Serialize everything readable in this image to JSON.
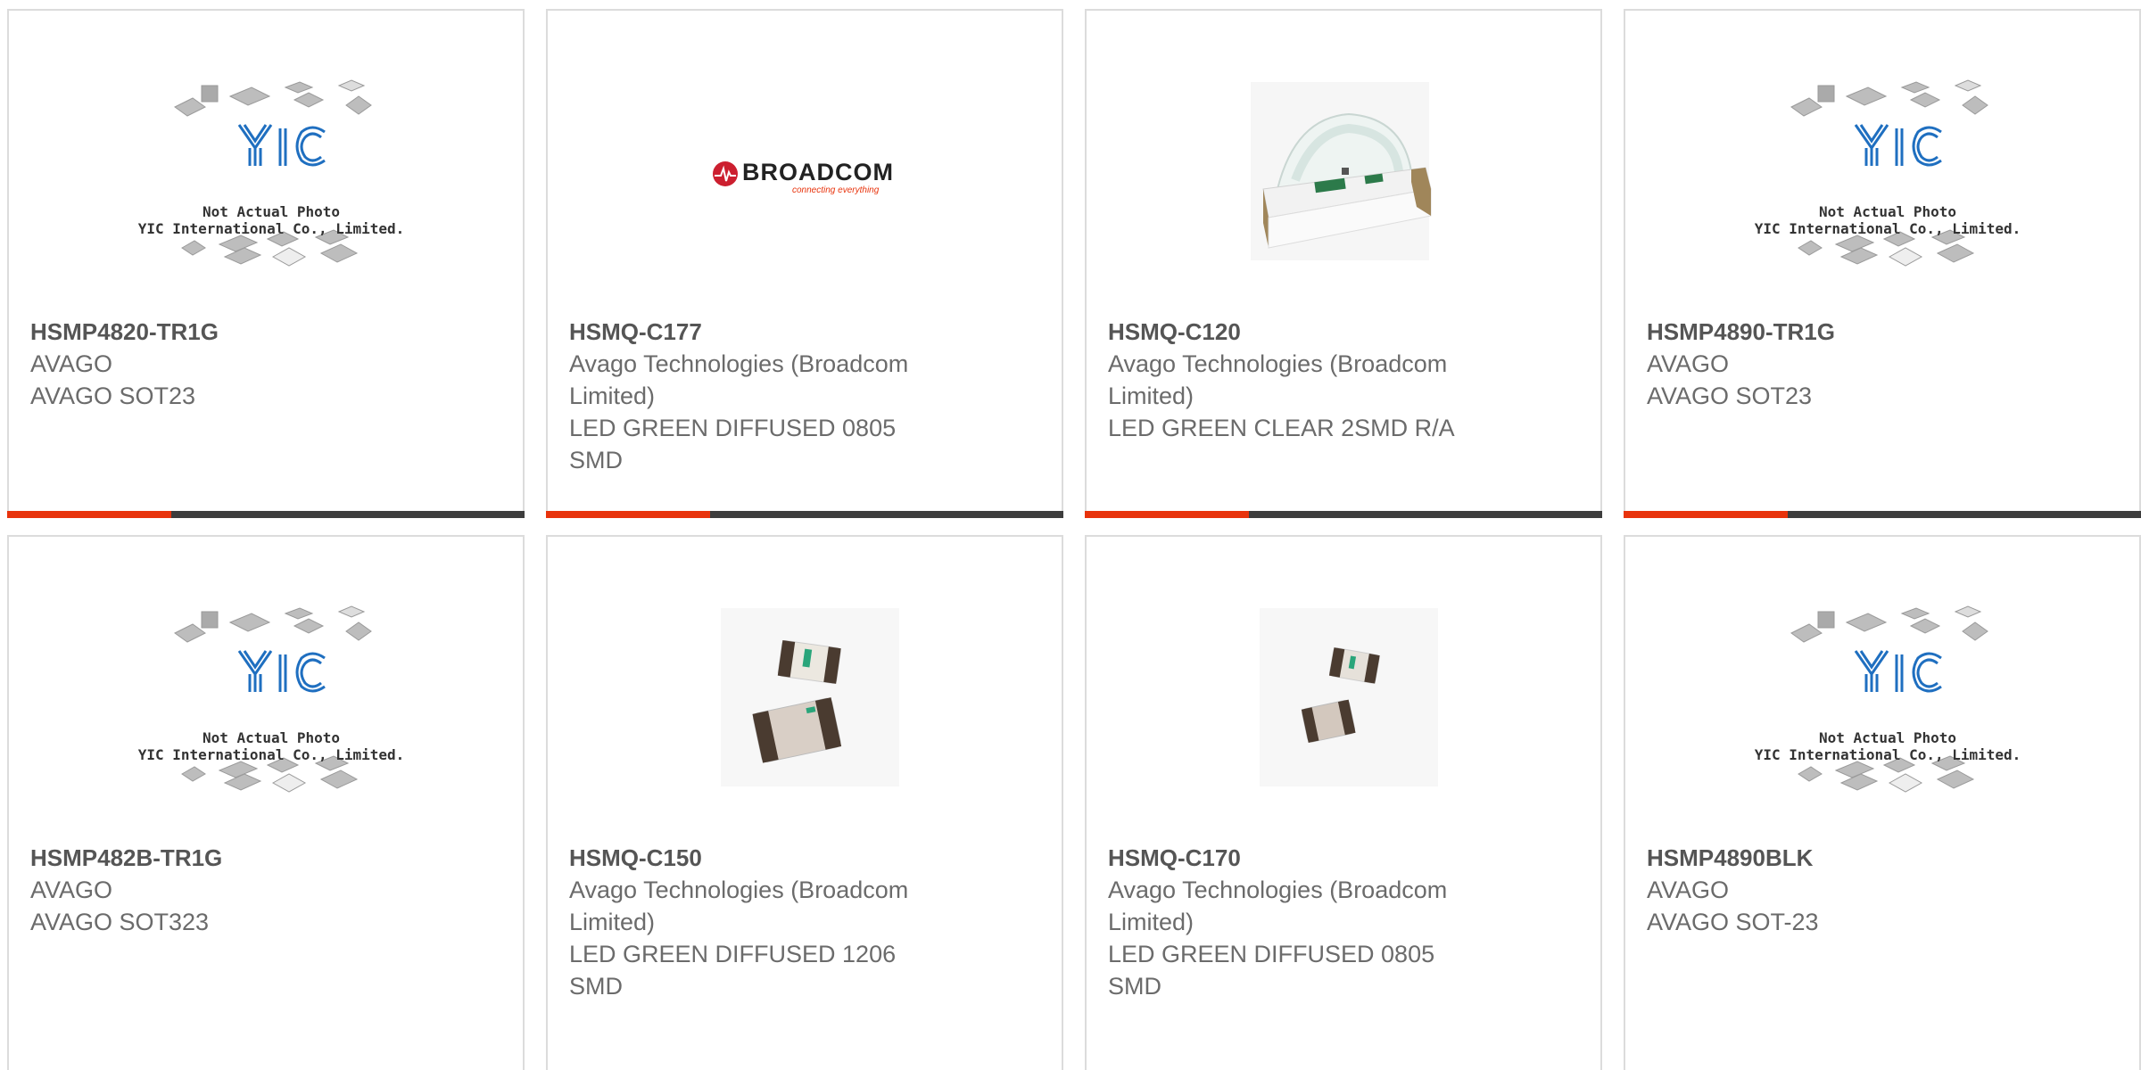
{
  "products": [
    {
      "part_number": "HSMP4820-TR1G",
      "lines": [
        "AVAGO",
        "AVAGO SOT23"
      ],
      "image": "placeholder",
      "placeholder_text": [
        "Not Actual Photo",
        "YIC International Co., Limited."
      ],
      "placeholder_logo": "YIC"
    },
    {
      "part_number": "HSMQ-C177",
      "lines": [
        "Avago Technologies (Broadcom",
        "Limited)",
        "LED GREEN DIFFUSED 0805",
        "SMD"
      ],
      "image": "broadcom-logo",
      "logo_word": "BROADCOM",
      "logo_tagline": "connecting everything"
    },
    {
      "part_number": "HSMQ-C120",
      "lines": [
        "Avago Technologies (Broadcom",
        "Limited)",
        "LED GREEN CLEAR 2SMD R/A"
      ],
      "image": "led-right-angle-photo"
    },
    {
      "part_number": "HSMP4890-TR1G",
      "lines": [
        "AVAGO",
        "AVAGO SOT23"
      ],
      "image": "placeholder",
      "placeholder_text": [
        "Not Actual Photo",
        "YIC International Co., Limited."
      ],
      "placeholder_logo": "YIC"
    },
    {
      "part_number": "HSMP482B-TR1G",
      "lines": [
        "AVAGO",
        "AVAGO SOT323"
      ],
      "image": "placeholder",
      "placeholder_text": [
        "Not Actual Photo",
        "YIC International Co., Limited."
      ],
      "placeholder_logo": "YIC"
    },
    {
      "part_number": "HSMQ-C150",
      "lines": [
        "Avago Technologies (Broadcom",
        "Limited)",
        "LED GREEN DIFFUSED 1206",
        "SMD"
      ],
      "image": "smd-led-photo"
    },
    {
      "part_number": "HSMQ-C170",
      "lines": [
        "Avago Technologies (Broadcom",
        "Limited)",
        "LED GREEN DIFFUSED 0805",
        "SMD"
      ],
      "image": "smd-led-photo"
    },
    {
      "part_number": "HSMP4890BLK",
      "lines": [
        "AVAGO",
        "AVAGO SOT-23"
      ],
      "image": "placeholder",
      "placeholder_text": [
        "Not Actual Photo",
        "YIC International Co., Limited."
      ],
      "placeholder_logo": "YIC"
    }
  ],
  "colors": {
    "accent": "#e8330c",
    "bar": "#3d3d3d",
    "border": "#dcdcdc",
    "part_number": "#555555",
    "text": "#6b6b6b",
    "yic_blue": "#1f6fc0"
  }
}
